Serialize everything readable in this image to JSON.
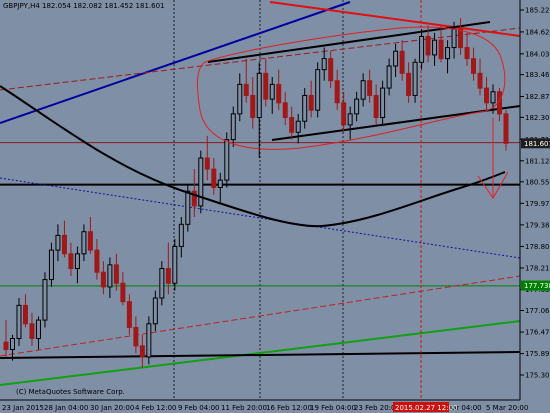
{
  "chart_data": {
    "type": "candlestick",
    "symbol_line": "GBPJPY,H4  182.054 182.082 181.452 181.601",
    "copyright": "(C) MetaQuotes Software Corp.",
    "y_ticks": [
      "185.220",
      "184.625",
      "184.030",
      "183.465",
      "182.870",
      "182.305",
      "181.710",
      "181.125",
      "180.555",
      "179.970",
      "179.385",
      "178.800",
      "178.215",
      "177.630",
      "177.060",
      "176.475",
      "175.890",
      "175.309"
    ],
    "y_tick_values": [
      185.22,
      184.625,
      184.03,
      183.465,
      182.87,
      182.305,
      181.71,
      181.125,
      180.555,
      179.97,
      179.385,
      178.8,
      178.215,
      177.63,
      177.06,
      176.475,
      175.89,
      175.309
    ],
    "ylim": [
      175.309,
      185.22
    ],
    "x_ticks": [
      "23 Jan 2015",
      "28 Jan 04:00",
      "30 Jan 20:00",
      "4 Feb 12:00",
      "9 Feb 04:00",
      "11 Feb 20:00",
      "16 Feb 12:00",
      "19 Feb 04:00",
      "23 Feb 20:00",
      "2015.02.27 12:00",
      "Mar 04:00",
      "5 Mar 20:00"
    ],
    "price_tags": [
      {
        "text": "181.601",
        "value": 181.601,
        "color": "#1e1e1e"
      },
      {
        "text": "177.738",
        "value": 177.738,
        "color": "#008000"
      }
    ],
    "horizontal_lines": [
      {
        "value": 180.48,
        "color": "#000000",
        "style": "solid"
      },
      {
        "value": 181.62,
        "color": "#8b1a1a",
        "style": "solid"
      },
      {
        "value": 177.73,
        "color": "#008000",
        "style": "solid"
      }
    ],
    "vertical_marker_label": "2015.02.27 12:00",
    "colors": {
      "background": "#7f8fa6",
      "bull_candle": "#000000",
      "bear_candle": "#a01818",
      "moving_average": "#000000",
      "upper_channel": "#0000a0",
      "lower_channel": "#10a010",
      "resistance": "#e01010",
      "highlight_ellipse": "#e02020"
    },
    "grid": true,
    "candles": [
      {
        "o": 176.2,
        "h": 176.8,
        "l": 175.8,
        "c": 176.0
      },
      {
        "o": 176.0,
        "h": 176.4,
        "l": 175.7,
        "c": 176.3
      },
      {
        "o": 176.3,
        "h": 177.4,
        "l": 176.1,
        "c": 177.2
      },
      {
        "o": 177.2,
        "h": 177.5,
        "l": 176.6,
        "c": 176.7
      },
      {
        "o": 176.7,
        "h": 177.0,
        "l": 176.1,
        "c": 176.3
      },
      {
        "o": 176.3,
        "h": 176.9,
        "l": 176.0,
        "c": 176.8
      },
      {
        "o": 176.8,
        "h": 178.1,
        "l": 176.6,
        "c": 177.9
      },
      {
        "o": 177.9,
        "h": 178.9,
        "l": 177.7,
        "c": 178.7
      },
      {
        "o": 178.7,
        "h": 179.4,
        "l": 178.4,
        "c": 179.1
      },
      {
        "o": 179.1,
        "h": 179.5,
        "l": 178.5,
        "c": 178.6
      },
      {
        "o": 178.6,
        "h": 178.9,
        "l": 178.0,
        "c": 178.2
      },
      {
        "o": 178.2,
        "h": 178.8,
        "l": 177.8,
        "c": 178.6
      },
      {
        "o": 178.6,
        "h": 179.4,
        "l": 178.4,
        "c": 179.2
      },
      {
        "o": 179.2,
        "h": 179.6,
        "l": 178.6,
        "c": 178.7
      },
      {
        "o": 178.7,
        "h": 179.0,
        "l": 177.9,
        "c": 178.1
      },
      {
        "o": 178.1,
        "h": 178.4,
        "l": 177.5,
        "c": 177.7
      },
      {
        "o": 177.7,
        "h": 178.5,
        "l": 177.4,
        "c": 178.3
      },
      {
        "o": 178.3,
        "h": 178.6,
        "l": 177.6,
        "c": 177.8
      },
      {
        "o": 177.8,
        "h": 178.1,
        "l": 177.2,
        "c": 177.3
      },
      {
        "o": 177.3,
        "h": 177.5,
        "l": 176.4,
        "c": 176.6
      },
      {
        "o": 176.6,
        "h": 176.9,
        "l": 175.9,
        "c": 176.1
      },
      {
        "o": 176.1,
        "h": 176.4,
        "l": 175.5,
        "c": 175.8
      },
      {
        "o": 175.8,
        "h": 176.9,
        "l": 175.6,
        "c": 176.7
      },
      {
        "o": 176.7,
        "h": 177.6,
        "l": 176.5,
        "c": 177.4
      },
      {
        "o": 177.4,
        "h": 178.4,
        "l": 177.2,
        "c": 178.2
      },
      {
        "o": 178.2,
        "h": 178.9,
        "l": 177.5,
        "c": 177.8
      },
      {
        "o": 177.8,
        "h": 179.0,
        "l": 177.6,
        "c": 178.8
      },
      {
        "o": 178.8,
        "h": 179.6,
        "l": 178.5,
        "c": 179.4
      },
      {
        "o": 179.4,
        "h": 180.5,
        "l": 179.2,
        "c": 180.3
      },
      {
        "o": 180.3,
        "h": 180.9,
        "l": 179.6,
        "c": 179.9
      },
      {
        "o": 179.9,
        "h": 181.4,
        "l": 179.7,
        "c": 181.2
      },
      {
        "o": 181.2,
        "h": 181.8,
        "l": 180.6,
        "c": 180.9
      },
      {
        "o": 180.9,
        "h": 181.2,
        "l": 180.2,
        "c": 180.4
      },
      {
        "o": 180.4,
        "h": 180.8,
        "l": 180.0,
        "c": 180.6
      },
      {
        "o": 180.6,
        "h": 181.9,
        "l": 180.4,
        "c": 181.7
      },
      {
        "o": 181.7,
        "h": 182.6,
        "l": 181.5,
        "c": 182.4
      },
      {
        "o": 182.4,
        "h": 183.5,
        "l": 182.2,
        "c": 183.2
      },
      {
        "o": 183.2,
        "h": 183.9,
        "l": 182.7,
        "c": 182.9
      },
      {
        "o": 182.9,
        "h": 183.4,
        "l": 182.0,
        "c": 182.3
      },
      {
        "o": 182.3,
        "h": 183.8,
        "l": 181.2,
        "c": 183.5
      },
      {
        "o": 183.5,
        "h": 183.9,
        "l": 182.6,
        "c": 182.8
      },
      {
        "o": 182.8,
        "h": 183.4,
        "l": 182.4,
        "c": 183.2
      },
      {
        "o": 183.2,
        "h": 183.6,
        "l": 182.5,
        "c": 182.7
      },
      {
        "o": 182.7,
        "h": 183.0,
        "l": 182.1,
        "c": 182.3
      },
      {
        "o": 182.3,
        "h": 182.6,
        "l": 181.7,
        "c": 181.9
      },
      {
        "o": 181.9,
        "h": 182.4,
        "l": 181.6,
        "c": 182.2
      },
      {
        "o": 182.2,
        "h": 183.1,
        "l": 182.0,
        "c": 182.9
      },
      {
        "o": 182.9,
        "h": 183.3,
        "l": 182.3,
        "c": 182.5
      },
      {
        "o": 182.5,
        "h": 183.8,
        "l": 182.3,
        "c": 183.6
      },
      {
        "o": 183.6,
        "h": 184.2,
        "l": 183.3,
        "c": 183.9
      },
      {
        "o": 183.9,
        "h": 184.1,
        "l": 183.1,
        "c": 183.3
      },
      {
        "o": 183.3,
        "h": 183.6,
        "l": 182.5,
        "c": 182.7
      },
      {
        "o": 182.7,
        "h": 183.0,
        "l": 181.9,
        "c": 182.1
      },
      {
        "o": 182.1,
        "h": 182.6,
        "l": 181.7,
        "c": 182.4
      },
      {
        "o": 182.4,
        "h": 183.0,
        "l": 182.2,
        "c": 182.8
      },
      {
        "o": 182.8,
        "h": 183.5,
        "l": 182.6,
        "c": 183.3
      },
      {
        "o": 183.3,
        "h": 183.6,
        "l": 182.7,
        "c": 182.9
      },
      {
        "o": 182.9,
        "h": 183.2,
        "l": 182.1,
        "c": 182.3
      },
      {
        "o": 182.3,
        "h": 183.3,
        "l": 182.1,
        "c": 183.1
      },
      {
        "o": 183.1,
        "h": 183.9,
        "l": 182.9,
        "c": 183.7
      },
      {
        "o": 183.7,
        "h": 184.3,
        "l": 183.4,
        "c": 184.1
      },
      {
        "o": 184.1,
        "h": 184.4,
        "l": 183.3,
        "c": 183.5
      },
      {
        "o": 183.5,
        "h": 183.8,
        "l": 182.7,
        "c": 182.9
      },
      {
        "o": 182.9,
        "h": 183.9,
        "l": 182.7,
        "c": 183.8
      },
      {
        "o": 183.8,
        "h": 184.7,
        "l": 183.6,
        "c": 184.5
      },
      {
        "o": 184.5,
        "h": 184.8,
        "l": 183.8,
        "c": 184.0
      },
      {
        "o": 184.0,
        "h": 184.6,
        "l": 183.7,
        "c": 184.4
      },
      {
        "o": 184.4,
        "h": 184.8,
        "l": 183.8,
        "c": 183.9
      },
      {
        "o": 183.9,
        "h": 184.4,
        "l": 183.5,
        "c": 184.2
      },
      {
        "o": 184.2,
        "h": 184.9,
        "l": 183.9,
        "c": 184.7
      },
      {
        "o": 184.7,
        "h": 185.0,
        "l": 184.0,
        "c": 184.2
      },
      {
        "o": 184.2,
        "h": 184.6,
        "l": 183.7,
        "c": 183.9
      },
      {
        "o": 183.9,
        "h": 184.2,
        "l": 183.3,
        "c": 183.5
      },
      {
        "o": 183.5,
        "h": 183.9,
        "l": 182.9,
        "c": 183.1
      },
      {
        "o": 183.1,
        "h": 183.4,
        "l": 182.5,
        "c": 182.7
      },
      {
        "o": 182.7,
        "h": 183.2,
        "l": 182.4,
        "c": 183.0
      },
      {
        "o": 183.0,
        "h": 183.1,
        "l": 182.2,
        "c": 182.4
      },
      {
        "o": 182.4,
        "h": 182.5,
        "l": 181.4,
        "c": 181.6
      }
    ]
  }
}
